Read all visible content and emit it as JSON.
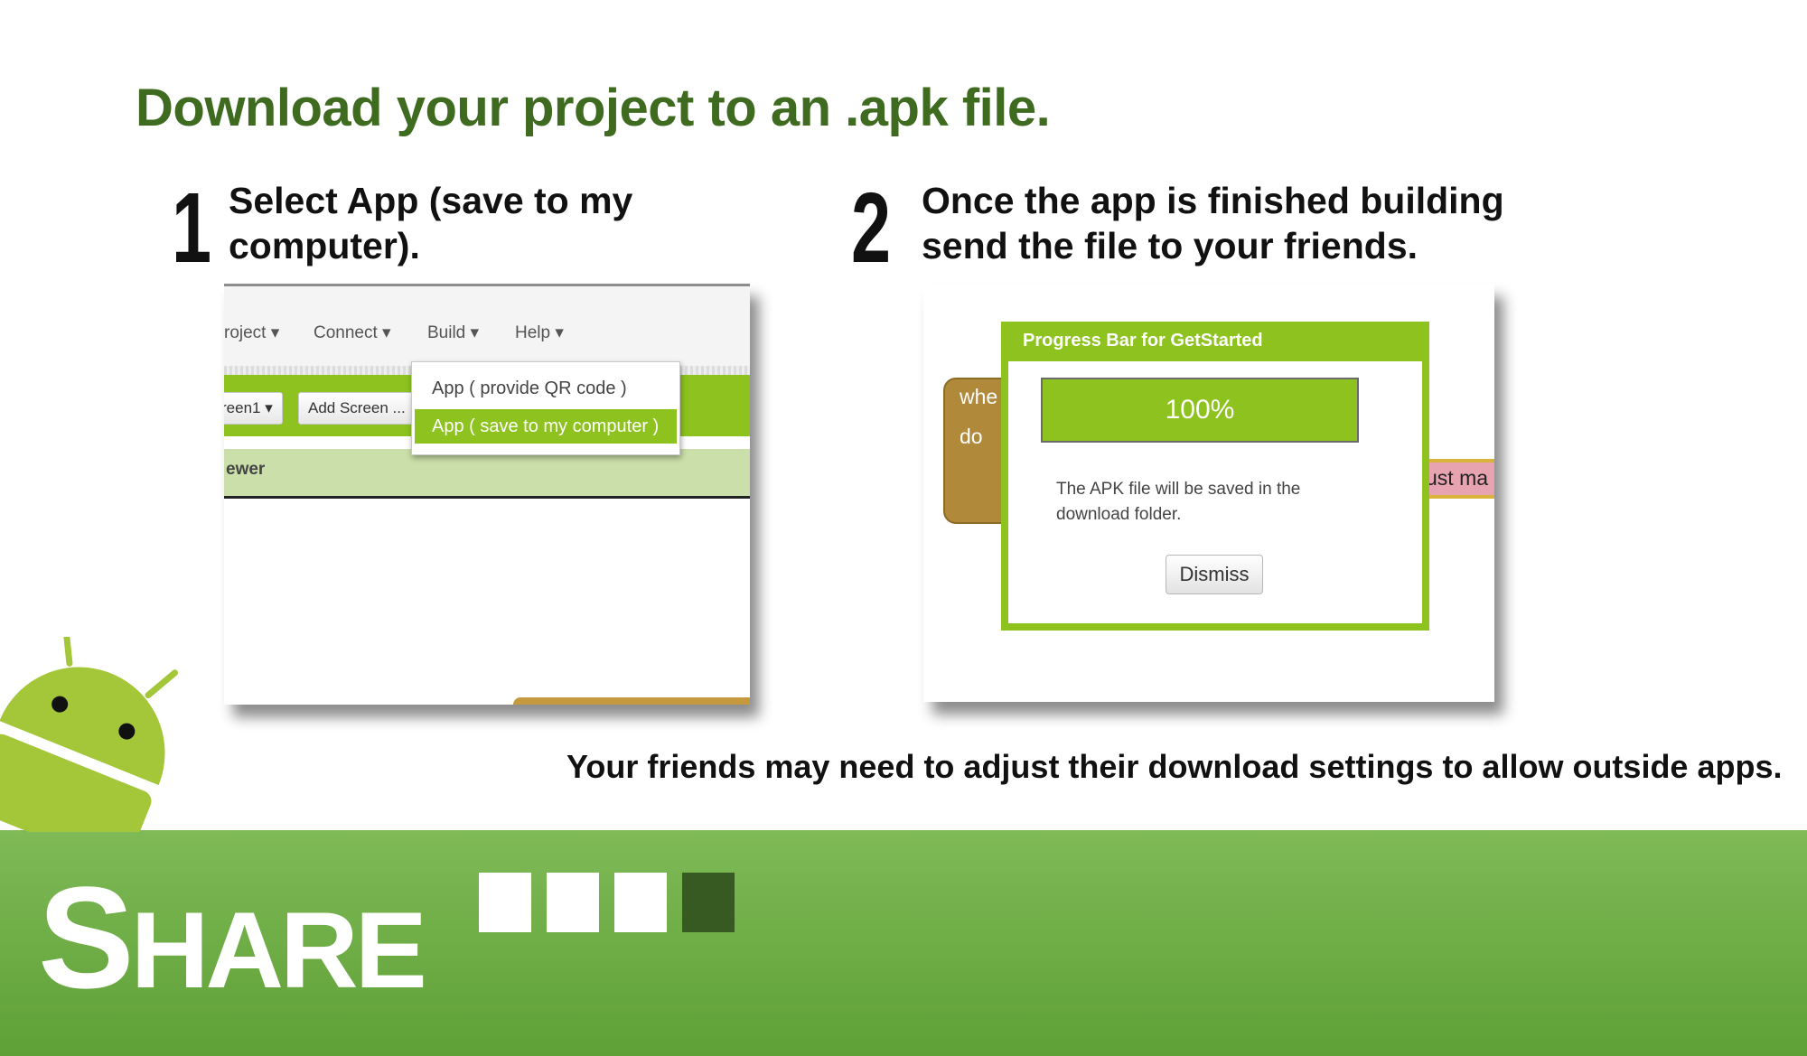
{
  "title": "Download your project to an .apk file.",
  "step1": {
    "number": "1",
    "line1": "Select App (save to my",
    "line2": "computer)."
  },
  "step2": {
    "number": "2",
    "line1": "Once the app is finished building",
    "line2": "send the file to your friends."
  },
  "screenshot1": {
    "menu": [
      "roject",
      "Connect",
      "Build",
      "Help"
    ],
    "screen_button": "reen1",
    "add_screen_button": "Add Screen ...",
    "viewer_label": "ewer",
    "dropdown": {
      "items": [
        "App ( provide QR code )",
        "App ( save to my computer )"
      ],
      "selected": "App ( save to my computer )"
    }
  },
  "screenshot2": {
    "block_when": "whe",
    "block_do": "do",
    "block_text": "ust ma",
    "dialog_title": "Progress Bar for GetStarted",
    "progress_text": "100%",
    "progress_value": 1.0,
    "message": "The APK file will be saved in the download folder.",
    "dismiss_label": "Dismiss"
  },
  "note": "Your friends may need to adjust their download settings to allow outside apps.",
  "banner": {
    "share_first": "S",
    "share_rest": "HARE",
    "squares": [
      "#ffffff",
      "#ffffff",
      "#ffffff",
      "#375a22"
    ]
  },
  "colors": {
    "title_green": "#3e6b1f",
    "accent_green": "#8dc21f",
    "band_green": "#6aab40",
    "android_green": "#a4c639"
  }
}
